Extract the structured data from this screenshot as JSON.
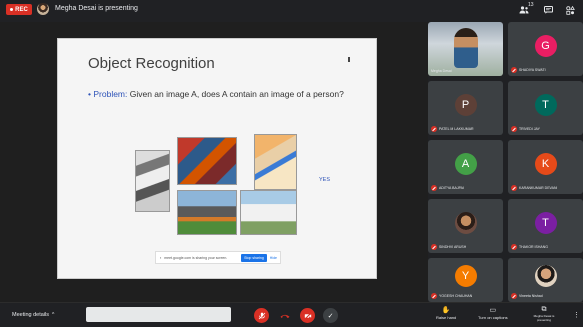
{
  "topbar": {
    "rec_label": "REC",
    "presenting_text": "Megha Desai is presenting",
    "people_count": "13",
    "icons": [
      "people-icon",
      "chat-icon",
      "activities-icon"
    ]
  },
  "slide": {
    "title": "Object Recognition",
    "bullet": "•",
    "problem_label": "Problem:",
    "problem_text": " Given an image A, does A contain an image of a person?",
    "yes_label": "YES",
    "share_bar": {
      "message": "meet.google.com is sharing your screen.",
      "stop_label": "Stop sharing",
      "hide_label": "Hide"
    }
  },
  "participants": [
    {
      "name": "Megha Desai",
      "type": "video"
    },
    {
      "name": "SHADIYA SWATI",
      "initial": "G",
      "color": "#e91e63"
    },
    {
      "name": "PATEL M LAKKUMAR",
      "initial": "P",
      "color": "#5d4037"
    },
    {
      "name": "TRIVEDI JAY",
      "initial": "T",
      "color": "#00695c"
    },
    {
      "name": "ADITYA BAJPAI",
      "initial": "A",
      "color": "#43a047"
    },
    {
      "name": "KARANKUMAR DEVANI",
      "initial": "K",
      "color": "#e64a19"
    },
    {
      "name": "SINDHVI ARUSH",
      "initial": "",
      "color": "#333333",
      "photo": true
    },
    {
      "name": "THAKOR ISHANG",
      "initial": "T",
      "color": "#7b1fa2"
    },
    {
      "name": "YOGESH CHAUHAN",
      "initial": "Y",
      "color": "#f57c00"
    },
    {
      "name": "Vineeta Nishad",
      "initial": "",
      "color": "#eeeeee",
      "photo": true
    }
  ],
  "bottombar": {
    "meeting_details": "Meeting details",
    "raise_hand": "Raise hand",
    "captions": "Turn on captions",
    "presenting_label": "Megha Desai is presenting"
  },
  "colors": {
    "background": "#202124",
    "tile": "#3c4043",
    "danger": "#d93025",
    "accent": "#1a73e8"
  }
}
